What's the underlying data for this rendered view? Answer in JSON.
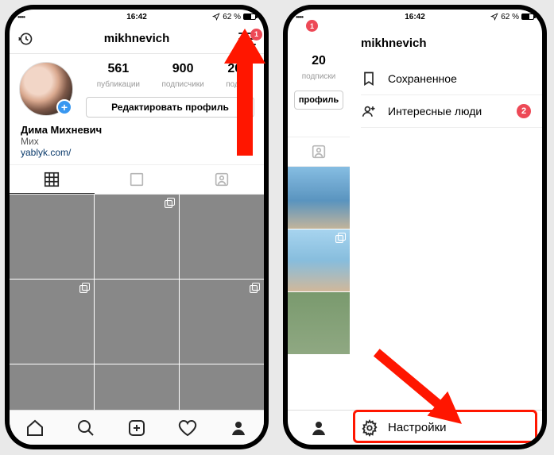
{
  "status": {
    "time": "16:42",
    "battery": "62 %"
  },
  "left": {
    "username": "mikhnevich",
    "menu_badge": "1",
    "stats": {
      "posts": {
        "n": "561",
        "l": "публикации"
      },
      "followers": {
        "n": "900",
        "l": "подписчики"
      },
      "following": {
        "n": "20",
        "l": "подп"
      }
    },
    "edit_button": "Редактировать профиль",
    "bio": {
      "name": "Дима Михневич",
      "sub": "Мих",
      "link": "yablyk.com/"
    }
  },
  "right": {
    "username": "mikhnevich",
    "menu_badge": "1",
    "stat": {
      "n": "20",
      "l": "подписки"
    },
    "edit_button": "профиль",
    "menu": {
      "saved": "Сохраненное",
      "discover": "Интересные люди",
      "discover_badge": "2"
    },
    "settings": "Настройки"
  }
}
